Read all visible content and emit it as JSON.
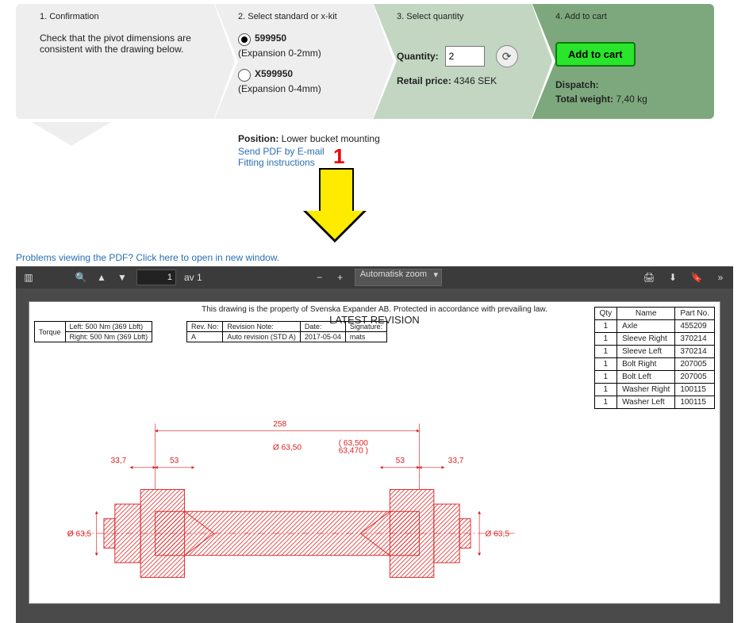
{
  "steps": {
    "s1": {
      "title": "1. Confirmation",
      "text": "Check that the pivot dimensions are consistent with the drawing below."
    },
    "s2": {
      "title": "2. Select standard or x-kit",
      "opt1": {
        "code": "599950",
        "desc": "(Expansion 0-2mm)"
      },
      "opt2": {
        "code": "X599950",
        "desc": "(Expansion 0-4mm)"
      }
    },
    "s3": {
      "title": "3. Select quantity",
      "qty_label": "Quantity:",
      "qty_value": "2",
      "price_label": "Retail price:",
      "price_value": "4346 SEK"
    },
    "s4": {
      "title": "4. Add to cart",
      "button": "Add to cart",
      "dispatch_label": "Dispatch:",
      "weight_label": "Total weight:",
      "weight_value": "7,40 kg"
    }
  },
  "info": {
    "position_label": "Position:",
    "position_value": "Lower bucket mounting",
    "send_pdf": "Send PDF by E-mail",
    "fitting": "Fitting instructions"
  },
  "annotation_number": "1",
  "problems_link": "Problems viewing the PDF? Click here to open in new window.",
  "toolbar": {
    "page_current": "1",
    "page_total": "av 1",
    "zoom_label": "Automatisk zoom"
  },
  "pdf": {
    "disclaimer": "This drawing is the property of Svenska Expander AB. Protected in accordance with prevailing law.",
    "latest": "LATEST REVISION",
    "torque_label": "Torque",
    "torque_left": "Left: 500 Nm (369 Lbft)",
    "torque_right": "Right: 500 Nm (369 Lbft)",
    "rev": {
      "no_h": "Rev. No:",
      "no": "A",
      "note_h": "Revision Note:",
      "note": "Auto revision (STD A)",
      "date_h": "Date:",
      "date": "2017-05-04",
      "sig_h": "Signature:",
      "sig": "mats"
    },
    "parts_header": {
      "qty": "Qty",
      "name": "Name",
      "partno": "Part No."
    },
    "parts": [
      {
        "qty": "1",
        "name": "Axle",
        "pn": "455209"
      },
      {
        "qty": "1",
        "name": "Sleeve Right",
        "pn": "370214"
      },
      {
        "qty": "1",
        "name": "Sleeve Left",
        "pn": "370214"
      },
      {
        "qty": "1",
        "name": "Bolt Right",
        "pn": "207005"
      },
      {
        "qty": "1",
        "name": "Bolt Left",
        "pn": "207005"
      },
      {
        "qty": "1",
        "name": "Washer Right",
        "pn": "100115"
      },
      {
        "qty": "1",
        "name": "Washer Left",
        "pn": "100115"
      }
    ],
    "dims": {
      "d258": "258",
      "d6350": "Ø 63,50",
      "tol": "63,500\n63,470",
      "d53a": "53",
      "d53b": "53",
      "d337a": "33,7",
      "d337b": "33,7",
      "d635l": "Ø 63,5",
      "d635r": "Ø 63,5"
    }
  }
}
